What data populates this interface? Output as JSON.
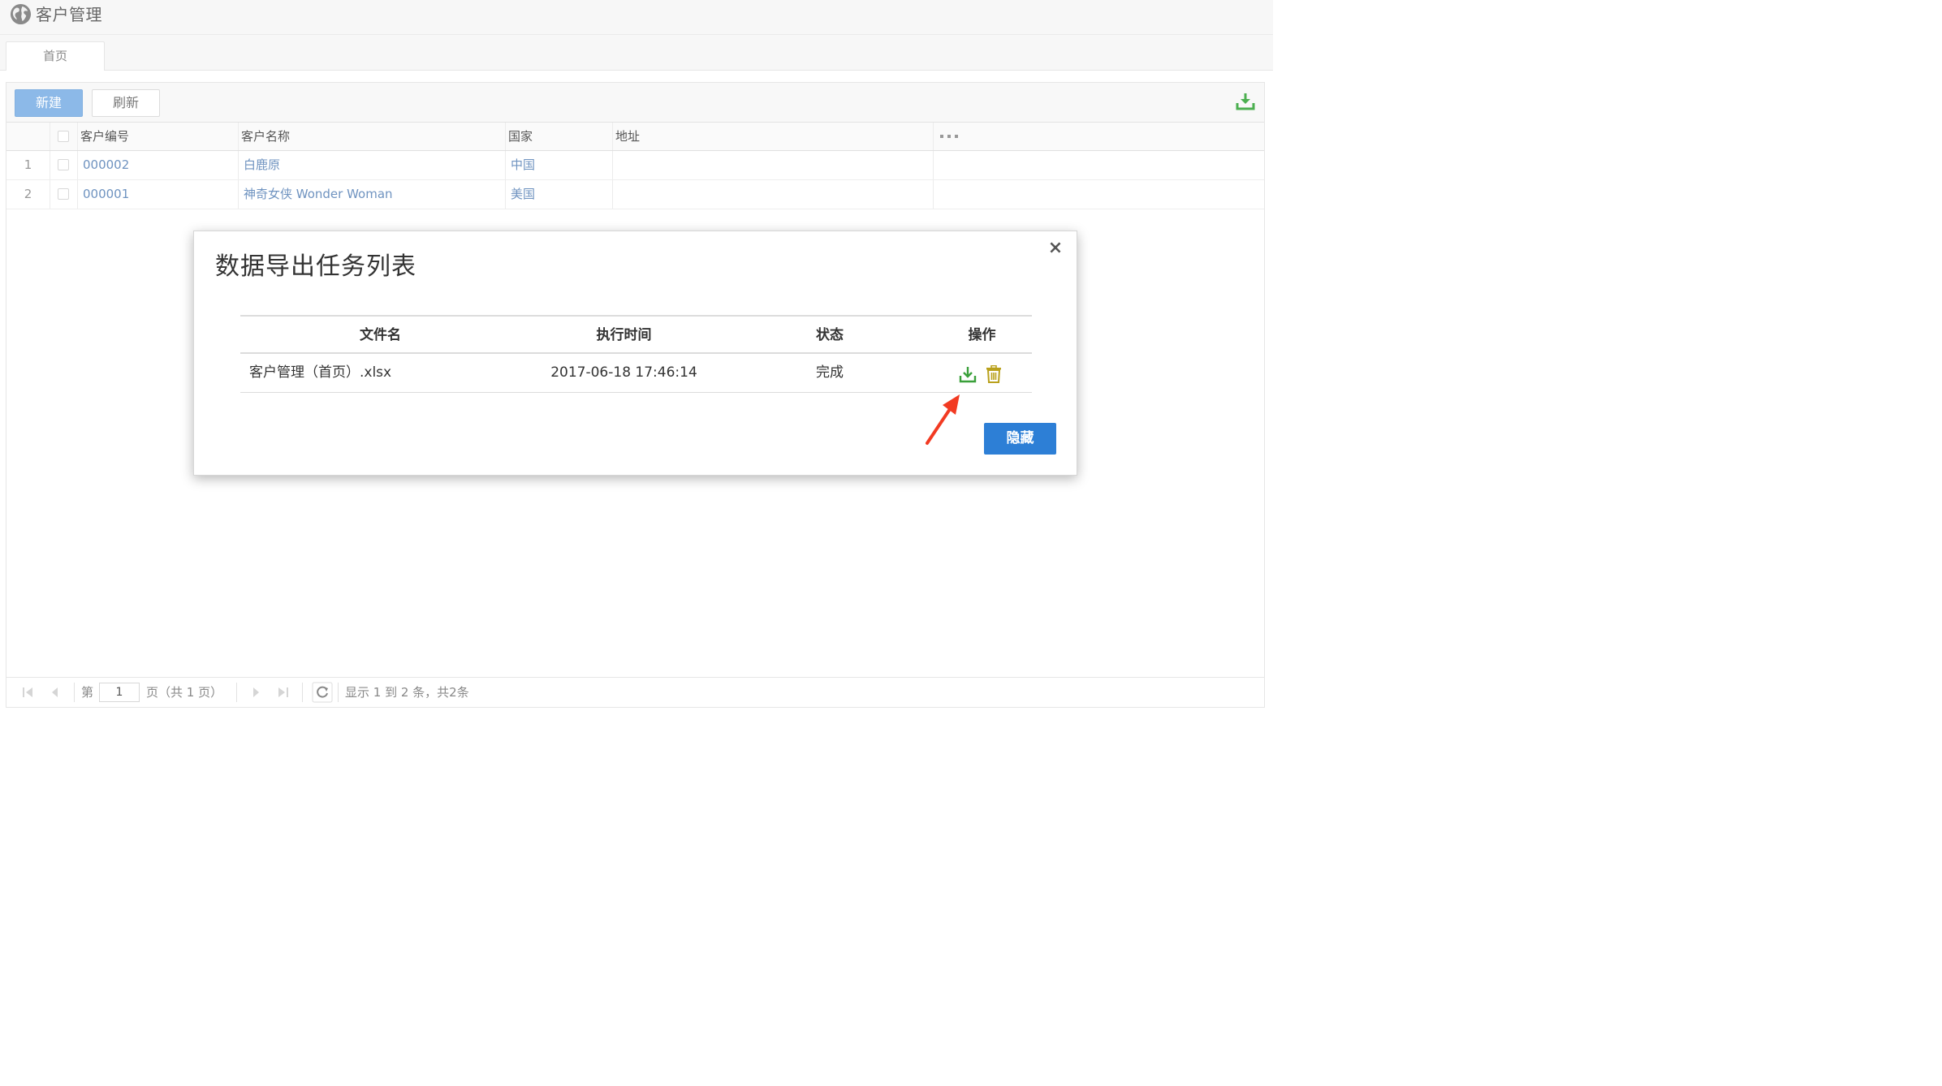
{
  "header": {
    "title": "客户管理"
  },
  "tabs": [
    {
      "label": "首页"
    }
  ],
  "toolbar": {
    "new_label": "新建",
    "refresh_label": "刷新"
  },
  "grid": {
    "columns": [
      "客户编号",
      "客户名称",
      "国家",
      "地址",
      "..."
    ],
    "rows": [
      {
        "index": "1",
        "code": "000002",
        "name": "白鹿原",
        "country": "中国",
        "address": ""
      },
      {
        "index": "2",
        "code": "000001",
        "name": "神奇女侠 Wonder Woman",
        "country": "美国",
        "address": ""
      }
    ]
  },
  "pager": {
    "page_prefix": "第",
    "page_value": "1",
    "page_suffix": "页（共 1 页）",
    "summary": "显示 1 到 2 条，共2条"
  },
  "modal": {
    "title": "数据导出任务列表",
    "close_label": "×",
    "columns": {
      "file": "文件名",
      "time": "执行时间",
      "status": "状态",
      "ops": "操作"
    },
    "rows": [
      {
        "file": "客户管理（首页）.xlsx",
        "time": "2017-06-18 17:46:14",
        "status": "完成"
      }
    ],
    "hide_label": "隐藏"
  },
  "colors": {
    "primary": "#2d7fd6",
    "primary_light": "#8cb9e8",
    "link": "#6f93c0",
    "download_green": "#3aa03a",
    "delete_olive": "#b9a11c",
    "annotation_red": "#f23a22"
  },
  "icons": [
    "globe-icon",
    "export-download-icon",
    "download-icon",
    "trash-icon",
    "close-icon",
    "first-page-icon",
    "prev-page-icon",
    "next-page-icon",
    "last-page-icon",
    "refresh-icon"
  ]
}
